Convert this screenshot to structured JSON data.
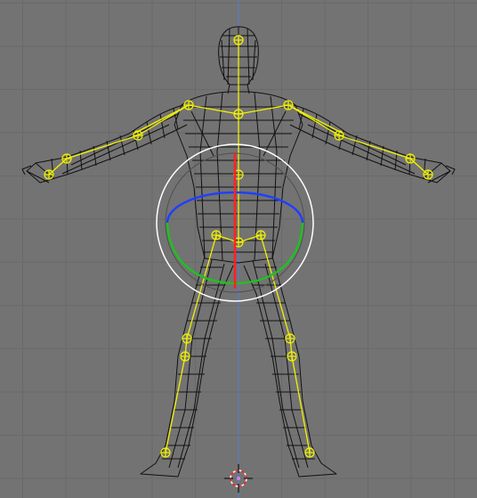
{
  "viewport": {
    "view": "front-orthographic",
    "background_color": "#737373",
    "grid": {
      "shown": true,
      "color": "#6a6a6a",
      "axis_vertical_color": "#5b7bd0"
    },
    "mode": "rotate-manipulator",
    "cursor": "3d-cursor"
  },
  "model": {
    "wireframe_color": "#111111",
    "rig_color": "#f2f200",
    "joints": [
      "head-joint",
      "chest-joint",
      "shoulder-left-joint",
      "shoulder-right-joint",
      "elbow-left-joint",
      "elbow-right-joint",
      "wrist-left-joint",
      "wrist-right-joint",
      "hand-left-joint",
      "hand-right-joint",
      "spine-joint",
      "hip-center-joint",
      "hip-left-joint",
      "hip-right-joint",
      "knee-left-joint",
      "knee-right-joint",
      "shin-left-joint",
      "shin-right-joint",
      "ankle-left-joint",
      "ankle-right-joint"
    ]
  },
  "manipulator": {
    "type": "rotate",
    "outer_ring_color": "#ffffff",
    "trackball_color": "#505050",
    "x_ring_color": "#ff2020",
    "y_ring_color": "#20c020",
    "z_ring_color": "#2040ff"
  }
}
